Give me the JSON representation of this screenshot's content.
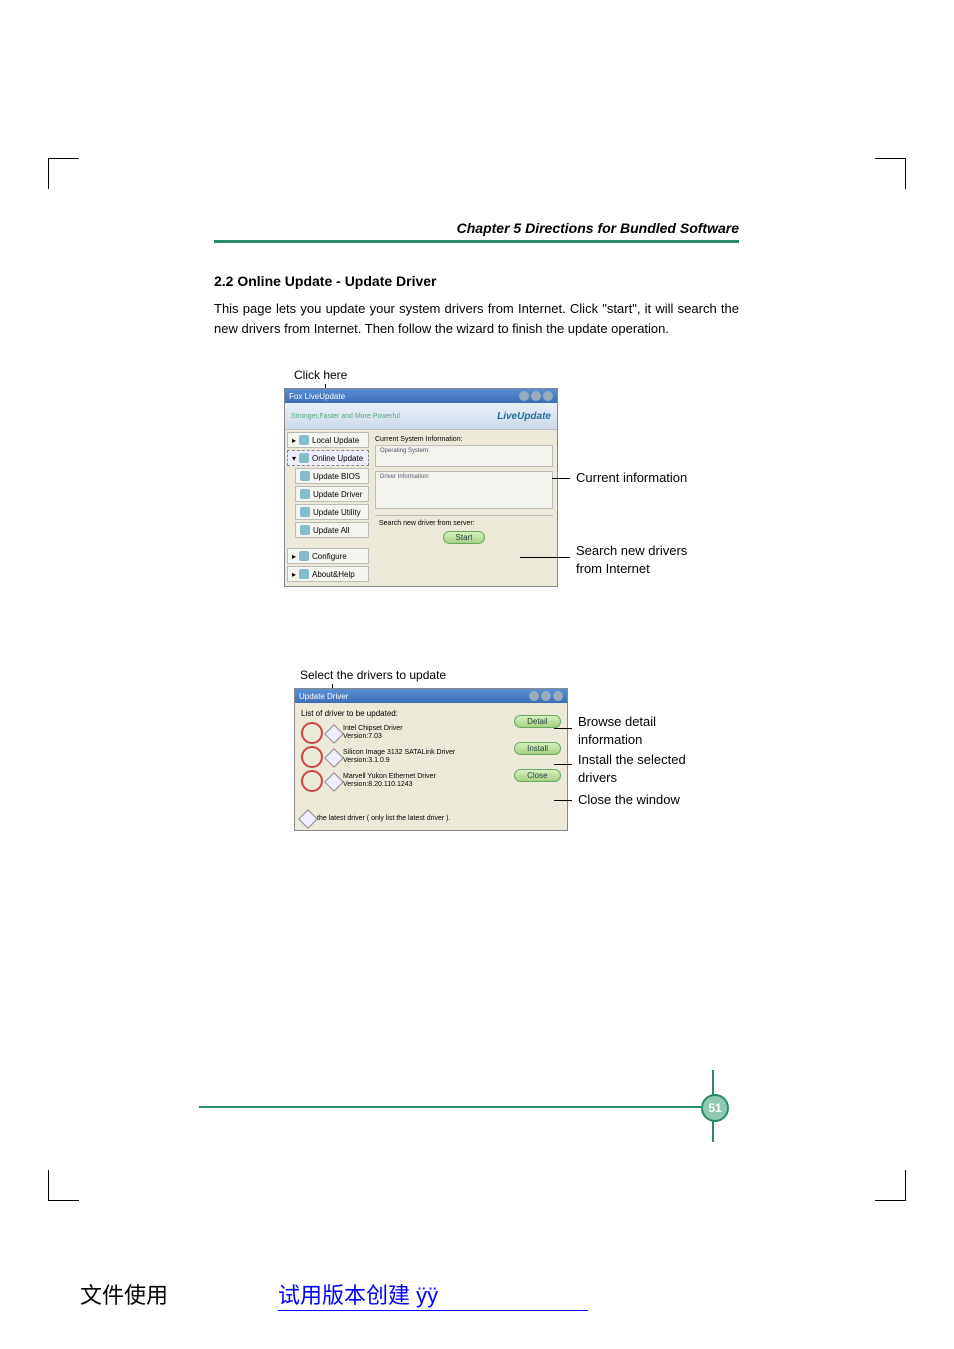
{
  "header": {
    "chapter": "Chapter 5     Directions for Bundled Software"
  },
  "section": {
    "title": "2.2 Online Update - Update Driver",
    "body": "This page lets you update your system drivers from Internet. Click \"start\", it will search the new drivers from Internet. Then follow the wizard to finish the update operation."
  },
  "fig1": {
    "callout_top": "Click here",
    "title": "Fox LiveUpdate",
    "tagline": "Stronger,Faster and More Powerful",
    "brand": "LiveUpdate",
    "sidebar": {
      "local": "Local Update",
      "online": "Online Update",
      "bios": "Update BIOS",
      "driver": "Update Driver",
      "utility": "Update Utility",
      "all": "Update All",
      "configure": "Configure",
      "about": "About&Help"
    },
    "main": {
      "label1": "Current System Information:",
      "os_label": "Operating System:",
      "drv_label": "Driver Information:",
      "search_label": "Search new driver from server:",
      "start_btn": "Start"
    },
    "right": {
      "r1": "Current information",
      "r2": "Search new drivers",
      "r3": "from Internet"
    }
  },
  "fig2": {
    "callout_top": "Select the drivers to update",
    "title": "Update Driver",
    "list_label": "List of driver to be updated:",
    "drivers": [
      {
        "name": "Intel Chipset Driver",
        "ver": "Version:7.03"
      },
      {
        "name": "Silicon Image 3132 SATALink Driver",
        "ver": "Version:3.1.0.9"
      },
      {
        "name": "Marvell Yukon Ethernet Driver",
        "ver": "Version:8.20.110.1243"
      }
    ],
    "buttons": {
      "detail": "Detail",
      "install": "Install",
      "close": "Close"
    },
    "note": "the latest driver ( only list the latest driver ).",
    "right": {
      "r1a": "Browse detail",
      "r1b": "information",
      "r2a": "Install the selected",
      "r2b": "drivers",
      "r3": "Close the window"
    }
  },
  "page_number": "51",
  "footer": {
    "left": "文件使用",
    "mid": "试用版本创建 ",
    "sym": "ÿÿ"
  }
}
